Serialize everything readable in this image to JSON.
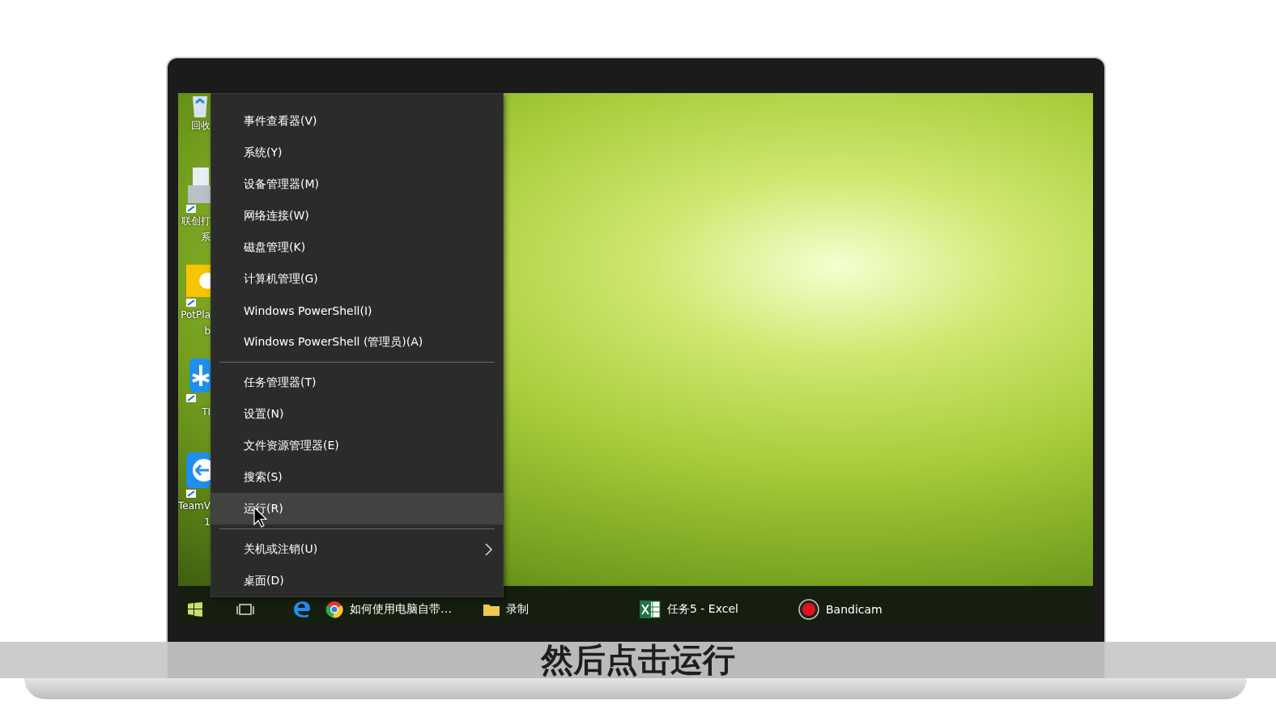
{
  "desktop_icons": [
    {
      "kind": "recycle",
      "labels": [
        "回收"
      ]
    },
    {
      "kind": "printer",
      "labels": [
        "联创打",
        "系"
      ]
    },
    {
      "kind": "player",
      "labels": [
        "PotPla",
        "b"
      ]
    },
    {
      "kind": "tim",
      "labels": [
        "TI"
      ]
    },
    {
      "kind": "teamviewer",
      "labels": [
        "TeamV",
        "1"
      ]
    }
  ],
  "context_menu": {
    "groups": [
      [
        {
          "label": "事件查看器(V)",
          "selected": false,
          "submenu": false
        },
        {
          "label": "系统(Y)",
          "selected": false,
          "submenu": false
        },
        {
          "label": "设备管理器(M)",
          "selected": false,
          "submenu": false
        },
        {
          "label": "网络连接(W)",
          "selected": false,
          "submenu": false
        },
        {
          "label": "磁盘管理(K)",
          "selected": false,
          "submenu": false
        },
        {
          "label": "计算机管理(G)",
          "selected": false,
          "submenu": false
        },
        {
          "label": "Windows PowerShell(I)",
          "selected": false,
          "submenu": false
        },
        {
          "label": "Windows PowerShell (管理员)(A)",
          "selected": false,
          "submenu": false
        }
      ],
      [
        {
          "label": "任务管理器(T)",
          "selected": false,
          "submenu": false
        },
        {
          "label": "设置(N)",
          "selected": false,
          "submenu": false
        },
        {
          "label": "文件资源管理器(E)",
          "selected": false,
          "submenu": false
        },
        {
          "label": "搜索(S)",
          "selected": false,
          "submenu": false
        },
        {
          "label": "运行(R)",
          "selected": true,
          "submenu": false
        }
      ],
      [
        {
          "label": "关机或注销(U)",
          "selected": false,
          "submenu": true
        },
        {
          "label": "桌面(D)",
          "selected": false,
          "submenu": false
        }
      ]
    ]
  },
  "taskbar": {
    "items": [
      {
        "kind": "start"
      },
      {
        "kind": "taskview"
      },
      {
        "kind": "edge"
      },
      {
        "kind": "chrome",
        "label": "如何使用电脑自带…"
      },
      {
        "kind": "folder",
        "label": "录制"
      },
      {
        "kind": "excel",
        "label": "任务5 - Excel"
      },
      {
        "kind": "bandicam",
        "label": "Bandicam"
      }
    ]
  },
  "subtitle": "然后点击运行"
}
